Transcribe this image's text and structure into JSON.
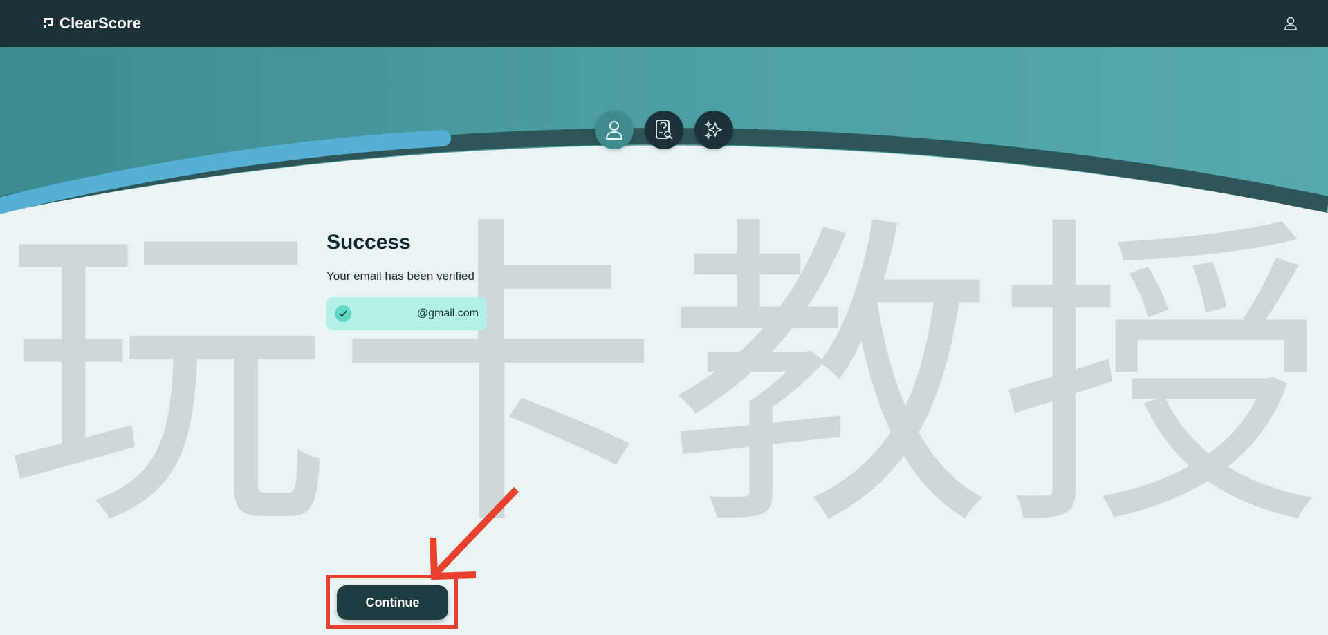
{
  "navbar": {
    "brand_name": "ClearScore",
    "brand_icon": "clearscore-logo-icon",
    "user_icon": "user-icon",
    "background": "#1b3338"
  },
  "progress": {
    "steps": [
      {
        "icon": "user-icon",
        "state": "active"
      },
      {
        "icon": "credit-report-search-icon",
        "state": "inactive"
      },
      {
        "icon": "sparkles-icon",
        "state": "inactive"
      }
    ],
    "track_color": "#2e5558",
    "progress_color": "#56b0d4",
    "progress_fraction": 0.33
  },
  "watermark": {
    "chars": [
      "玩",
      "卡",
      "教",
      "授"
    ]
  },
  "main": {
    "title": "Success",
    "subtitle": "Your email has been verified",
    "email": "@gmail.com",
    "continue_label": "Continue"
  },
  "colors": {
    "page_bg": "#e9f4f3",
    "pill_bg": "#b3f1e7",
    "check_bg": "#5fd9c6",
    "button_bg": "#1f3b42",
    "annotation": "#e8412e"
  }
}
